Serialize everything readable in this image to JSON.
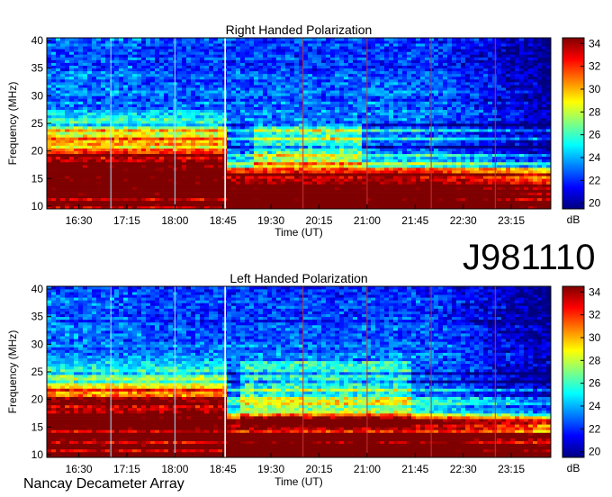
{
  "observation_id": "J981110",
  "credit": "Nancay Decameter Array",
  "chart_data": [
    {
      "type": "heatmap",
      "title": "Right Handed Polarization",
      "xlabel": "Time (UT)",
      "ylabel": "Frequency (MHz)",
      "x_ticks": [
        "16:30",
        "17:15",
        "18:00",
        "18:45",
        "19:30",
        "20:15",
        "21:00",
        "21:45",
        "22:30",
        "23:15"
      ],
      "y_ticks": [
        10,
        15,
        20,
        25,
        30,
        35,
        40
      ],
      "ylim": [
        9.5,
        40.5
      ],
      "colorbar": {
        "label": "dB",
        "ticks": [
          20,
          22,
          24,
          26,
          28,
          30,
          32,
          34
        ],
        "range": [
          19.5,
          34.5
        ]
      },
      "colormap": [
        "#00007f",
        "#0000ff",
        "#0080ff",
        "#00ffff",
        "#80ff80",
        "#ffff00",
        "#ff8000",
        "#ff0000",
        "#7f0000"
      ],
      "time_markers": [
        "17:00",
        "18:00",
        "18:47",
        "20:00",
        "21:00",
        "22:00",
        "23:00"
      ]
    },
    {
      "type": "heatmap",
      "title": "Left Handed Polarization",
      "xlabel": "Time (UT)",
      "ylabel": "Frequency (MHz)",
      "x_ticks": [
        "16:30",
        "17:15",
        "18:00",
        "18:45",
        "19:30",
        "20:15",
        "21:00",
        "21:45",
        "22:30",
        "23:15"
      ],
      "y_ticks": [
        10,
        15,
        20,
        25,
        30,
        35,
        40
      ],
      "ylim": [
        9.5,
        40.5
      ],
      "colorbar": {
        "label": "dB",
        "ticks": [
          20,
          22,
          24,
          26,
          28,
          30,
          32,
          34
        ],
        "range": [
          19.5,
          34.5
        ]
      },
      "colormap": [
        "#00007f",
        "#0000ff",
        "#0080ff",
        "#00ffff",
        "#80ff80",
        "#ffff00",
        "#ff8000",
        "#ff0000",
        "#7f0000"
      ],
      "time_markers": [
        "17:00",
        "18:00",
        "18:47",
        "20:00",
        "21:00",
        "22:00",
        "23:00"
      ]
    }
  ]
}
